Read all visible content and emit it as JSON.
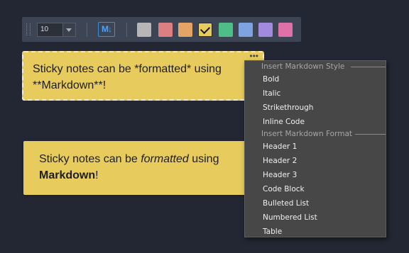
{
  "toolbar": {
    "font_size": "10",
    "markdown_button": "M↓",
    "swatches": [
      {
        "name": "gray",
        "color": "#b6b6b6",
        "selected": false
      },
      {
        "name": "red",
        "color": "#db7f82",
        "selected": false
      },
      {
        "name": "orange",
        "color": "#e3a465",
        "selected": false
      },
      {
        "name": "yellow",
        "color": "#e7cb5d",
        "selected": true
      },
      {
        "name": "green",
        "color": "#4fbe86",
        "selected": false
      },
      {
        "name": "blue",
        "color": "#7fa2e0",
        "selected": false
      },
      {
        "name": "purple",
        "color": "#a28bdf",
        "selected": false
      },
      {
        "name": "pink",
        "color": "#de72a8",
        "selected": false
      }
    ]
  },
  "note_editing": {
    "line1": "Sticky notes can be *formatted* using",
    "line2": "**Markdown**!",
    "menu_dots": "•••"
  },
  "note_rendered": {
    "before_italic": "Sticky notes can be ",
    "italic": "formatted",
    "after_italic": " using",
    "bold": "Markdown",
    "after_bold": "!"
  },
  "context_menu": {
    "style_header": "Insert Markdown Style",
    "style_items": [
      "Bold",
      "Italic",
      "Strikethrough",
      "Inline Code"
    ],
    "format_header": "Insert Markdown Format",
    "format_items": [
      "Header 1",
      "Header 2",
      "Header 3",
      "Code Block",
      "Bulleted List",
      "Numbered List",
      "Table"
    ]
  }
}
